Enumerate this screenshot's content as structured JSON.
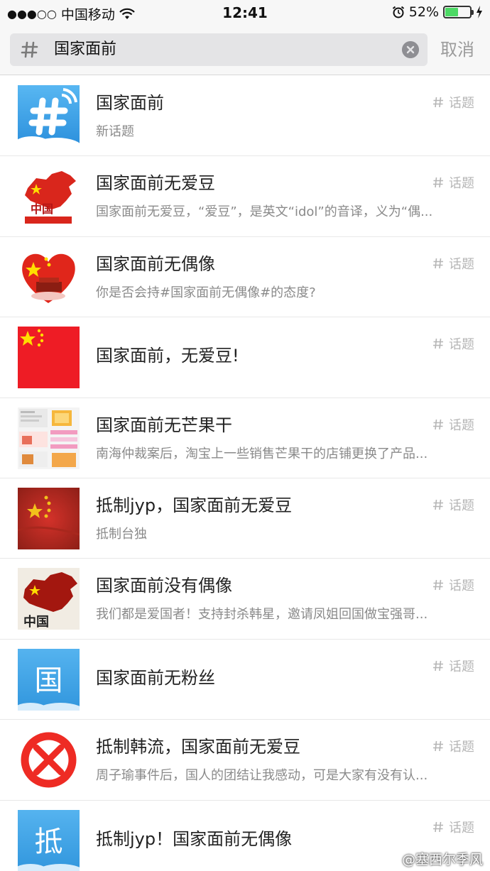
{
  "status_bar": {
    "signal": "●●●○○",
    "carrier": "中国移动",
    "time": "12:41",
    "battery_percent": "52%",
    "battery_level": 0.52
  },
  "search": {
    "query": "国家面前",
    "cancel_label": "取消"
  },
  "results": [
    {
      "title": "国家面前",
      "subtitle": "新话题",
      "tag": "话题",
      "thumb": "hash-icon"
    },
    {
      "title": "国家面前无爱豆",
      "subtitle": "国家面前无爱豆，“爱豆”，是英文“idol”的音译，义为“偶...",
      "tag": "话题",
      "thumb": "china-map",
      "thumb_text": "中国"
    },
    {
      "title": "国家面前无偶像",
      "subtitle": "你是否会持#国家面前无偶像#的态度?",
      "tag": "话题",
      "thumb": "heart-flag"
    },
    {
      "title": "国家面前，无爱豆!",
      "subtitle": "",
      "tag": "话题",
      "thumb": "china-flag"
    },
    {
      "title": "国家面前无芒果干",
      "subtitle": "南海仲裁案后，淘宝上一些销售芒果干的店铺更换了产品...",
      "tag": "话题",
      "thumb": "screenshot-collage"
    },
    {
      "title": "抵制jyp，国家面前无爱豆",
      "subtitle": "抵制台独",
      "tag": "话题",
      "thumb": "china-flag-textured"
    },
    {
      "title": "国家面前没有偶像",
      "subtitle": "我们都是爱国者！支持封杀韩星，邀请凤姐回国做宝强哥...",
      "tag": "话题",
      "thumb": "china-map-dark",
      "thumb_text": "中国"
    },
    {
      "title": "国家面前无粉丝",
      "subtitle": "",
      "tag": "话题",
      "thumb": "char-tile",
      "thumb_text": "国"
    },
    {
      "title": "抵制韩流，国家面前无爱豆",
      "subtitle": "周子瑜事件后，国人的团结让我感动，可是大家有没有认...",
      "tag": "话题",
      "thumb": "no-sign"
    },
    {
      "title": "抵制jyp！国家面前无偶像",
      "subtitle": "",
      "tag": "话题",
      "thumb": "char-tile",
      "thumb_text": "抵"
    }
  ],
  "watermark": "@塞西尔季风",
  "colors": {
    "flag_red": "#e8231a",
    "star_yellow": "#ffde00",
    "tile_blue": "#3aa7e8",
    "muted_text": "#8a8a8a"
  }
}
